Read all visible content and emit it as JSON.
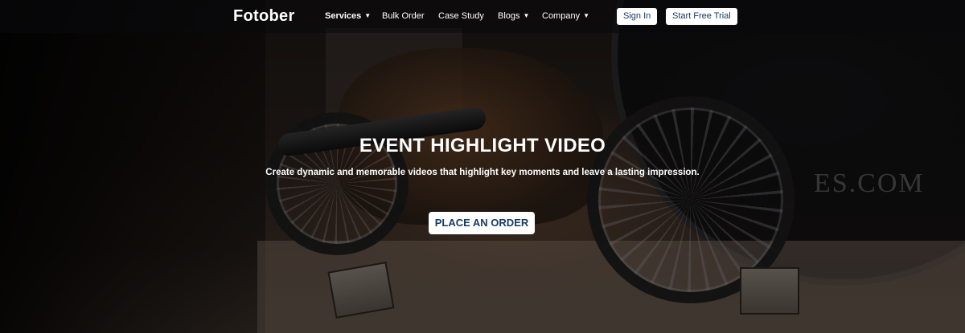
{
  "nav": {
    "logo": "Fotober",
    "items": [
      {
        "label": "Services",
        "has_caret": true,
        "active": true
      },
      {
        "label": "Bulk Order",
        "has_caret": false
      },
      {
        "label": "Case Study",
        "has_caret": false
      },
      {
        "label": "Blogs",
        "has_caret": true
      },
      {
        "label": "Company",
        "has_caret": true
      }
    ],
    "caret_glyph": "▼",
    "sign_in": "Sign In",
    "start_trial": "Start Free Trial"
  },
  "hero": {
    "title": "EVENT HIGHLIGHT VIDEO",
    "subtitle": "Create dynamic and memorable videos that highlight key moments and leave a lasting impression.",
    "cta": "PLACE AN ORDER",
    "background_text": "ES.COM"
  },
  "colors": {
    "cta_text": "#173a63",
    "button_bg": "#ffffff",
    "text": "#ffffff"
  }
}
